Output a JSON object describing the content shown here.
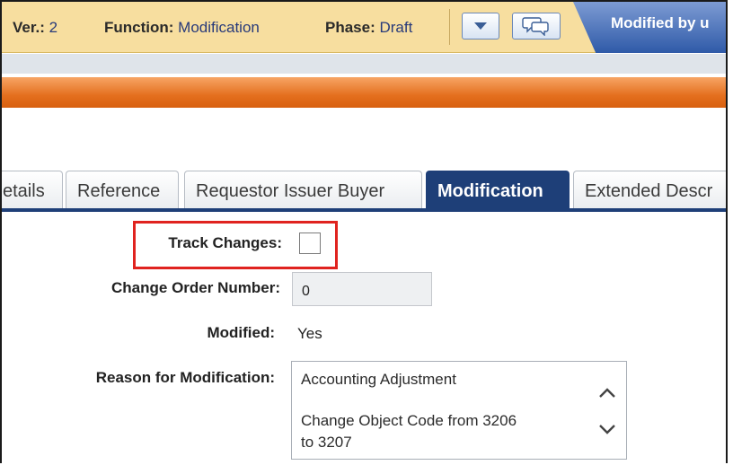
{
  "header": {
    "version_label": "Ver.:",
    "version_value": "2",
    "function_label": "Function:",
    "function_value": "Modification",
    "phase_label": "Phase:",
    "phase_value": "Draft",
    "modified_by_text": "Modified by u"
  },
  "tabs": [
    {
      "label": "etails"
    },
    {
      "label": "Reference"
    },
    {
      "label": "Requestor Issuer Buyer"
    },
    {
      "label": "Modification"
    },
    {
      "label": "Extended Descr"
    }
  ],
  "form": {
    "track_changes_label": "Track Changes:",
    "track_changes_checked": false,
    "change_order_label": "Change Order Number:",
    "change_order_value": "0",
    "modified_label": "Modified:",
    "modified_value": "Yes",
    "reason_label": "Reason for Modification:",
    "reason_lines": [
      "Accounting Adjustment",
      "",
      "Change Object Code from 3206",
      "to 3207"
    ]
  },
  "colors": {
    "header_bg": "#f7de9f",
    "orange_bar": "#e46f1e",
    "active_tab": "#1e3f78",
    "highlight_border": "#e0231f"
  }
}
